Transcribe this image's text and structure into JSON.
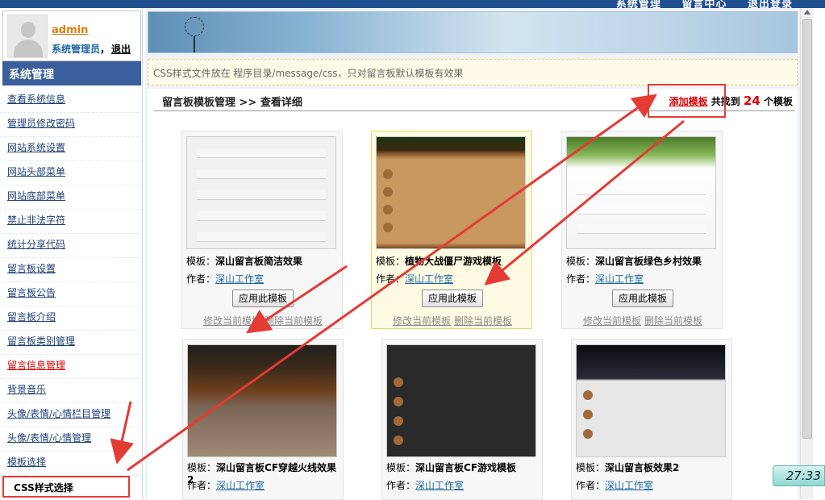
{
  "topbar": {
    "links": [
      "系统管理",
      "留言中心",
      "退出登录"
    ]
  },
  "user": {
    "name": "admin",
    "role": "系统管理员",
    "separator": "，",
    "logout": "退出"
  },
  "sidebar": {
    "title": "系统管理",
    "items": [
      {
        "label": "查看系统信息"
      },
      {
        "label": "管理员修改密码"
      },
      {
        "label": "网站系统设置"
      },
      {
        "label": "网站头部菜单"
      },
      {
        "label": "网站底部菜单"
      },
      {
        "label": "禁止非法字符"
      },
      {
        "label": "统计分享代码"
      },
      {
        "label": "留言板设置"
      },
      {
        "label": "留言板公告"
      },
      {
        "label": "留言板介绍"
      },
      {
        "label": "留言板类别管理"
      },
      {
        "label": "留言信息管理"
      },
      {
        "label": "背景音乐"
      },
      {
        "label": "头像/表情/心情栏目管理"
      },
      {
        "label": "头像/表情/心情管理"
      },
      {
        "label": "模板选择"
      },
      {
        "label": "CSS样式选择"
      }
    ]
  },
  "notice": "CSS样式文件放在 程序目录/message/css，只对留言板默认模板有效果",
  "content": {
    "title": "留言板模板管理 >> 查看详细",
    "add_label": "添加模板",
    "found_prefix": " 共找到 ",
    "count": "24",
    "found_suffix": " 个模板"
  },
  "templates": [
    {
      "name_label": "模板：",
      "name": "深山留言板简洁效果",
      "author_label": "作者：",
      "author": "深山工作室",
      "apply": "应用此模板",
      "edit": "修改当前模板",
      "delete": "删除当前模板"
    },
    {
      "name_label": "模板：",
      "name": "植物大战僵尸游戏模板",
      "author_label": "作者：",
      "author": "深山工作室",
      "apply": "应用此模板",
      "edit": "修改当前模板",
      "delete": "删除当前模板"
    },
    {
      "name_label": "模板：",
      "name": "深山留言板绿色乡村效果",
      "author_label": "作者：",
      "author": "深山工作室",
      "apply": "应用此模板",
      "edit": "修改当前模板",
      "delete": "删除当前模板"
    },
    {
      "name_label": "模板：",
      "name": "深山留言板CF穿越火线效果2",
      "author_label": "作者：",
      "author": "深山工作室"
    },
    {
      "name_label": "模板：",
      "name": "深山留言板CF游戏模板",
      "author_label": "作者：",
      "author": "深山工作室"
    },
    {
      "name_label": "模板：",
      "name": "深山留言板效果2",
      "author_label": "作者：",
      "author": "深山工作室"
    }
  ],
  "clock": "27:33"
}
